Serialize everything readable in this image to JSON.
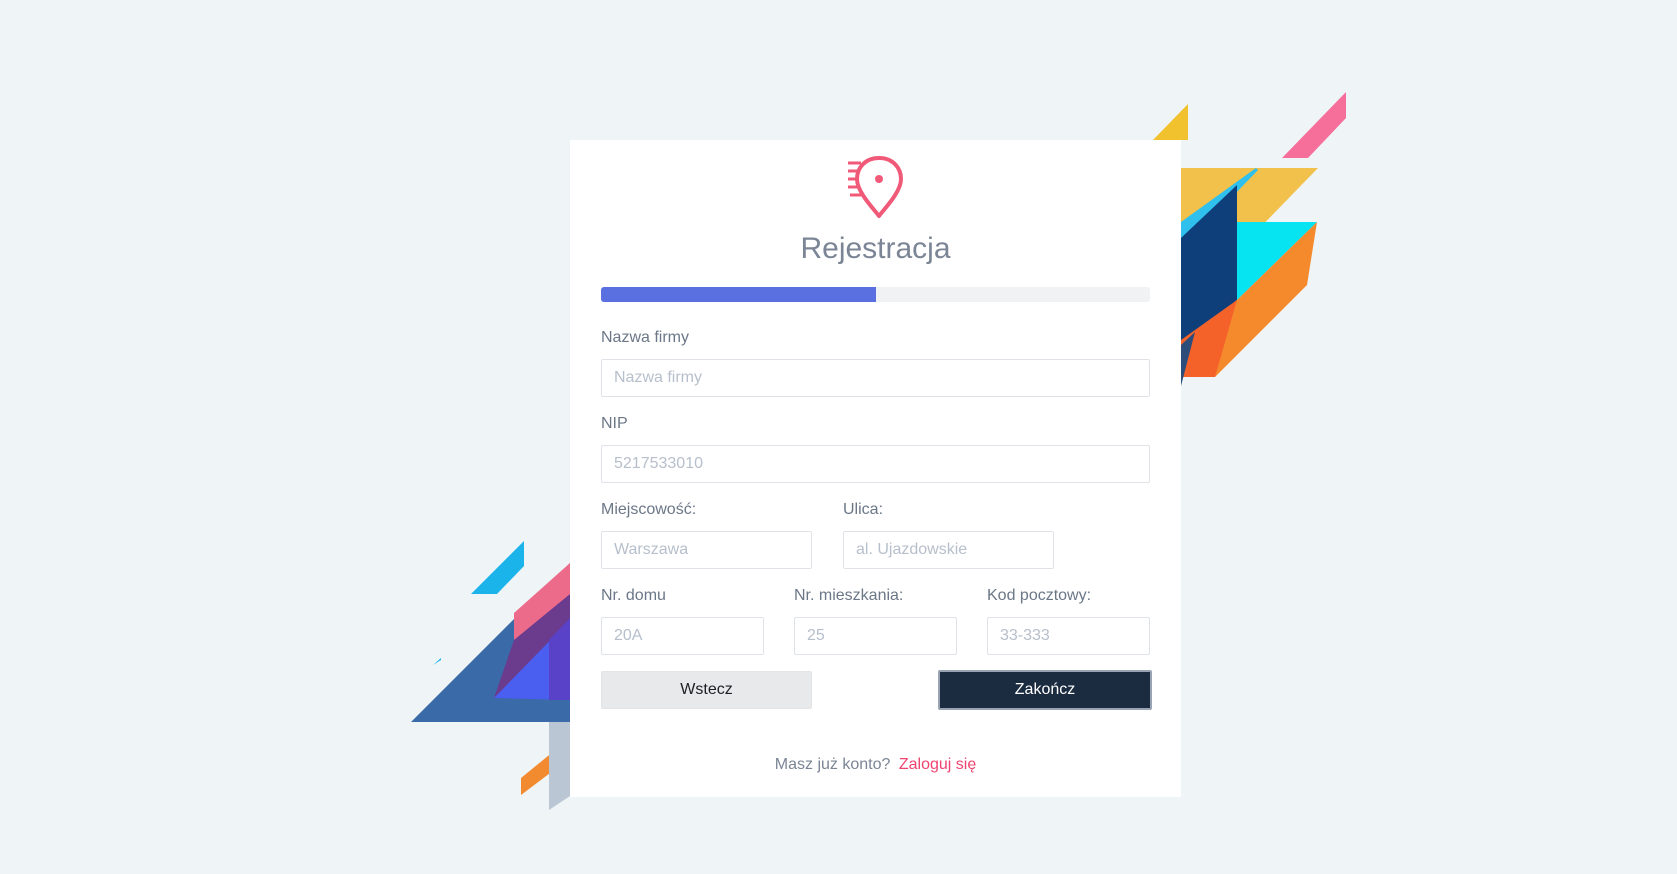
{
  "logo": {
    "icon": "location-pin-speed-icon",
    "color": "#f05a78"
  },
  "title": "Rejestracja",
  "progress": {
    "fraction": 0.5,
    "color": "#5a6fe0"
  },
  "form": {
    "company": {
      "label": "Nazwa firmy",
      "placeholder": "Nazwa firmy"
    },
    "nip": {
      "label": "NIP",
      "placeholder": "5217533010"
    },
    "city": {
      "label": "Miejscowość:",
      "placeholder": "Warszawa"
    },
    "street": {
      "label": "Ulica:",
      "placeholder": "al. Ujazdowskie"
    },
    "house_number": {
      "label": "Nr. domu",
      "placeholder": "20A"
    },
    "apartment_number": {
      "label": "Nr. mieszkania:",
      "placeholder": "25"
    },
    "postal_code": {
      "label": "Kod pocztowy:",
      "placeholder": "33-333"
    }
  },
  "buttons": {
    "back": "Wstecz",
    "finish": "Zakończ"
  },
  "footer": {
    "text": "Masz już konto?",
    "link": "Zaloguj się"
  }
}
